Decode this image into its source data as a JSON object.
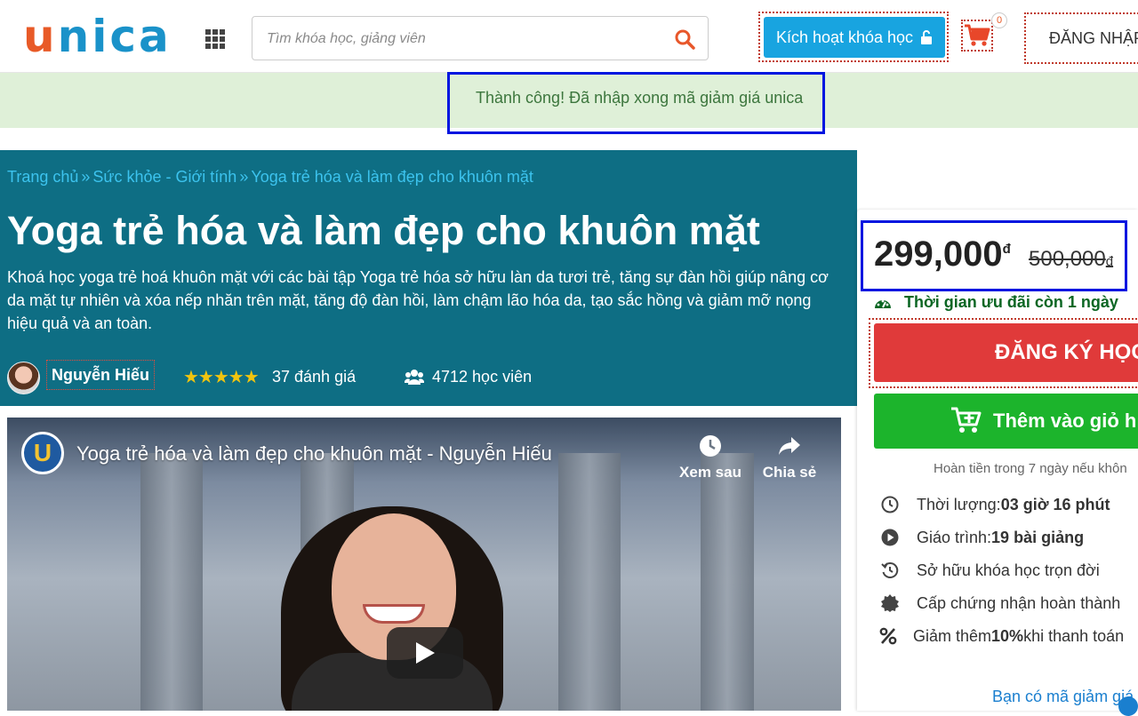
{
  "header": {
    "logo": "unica",
    "search_placeholder": "Tìm khóa học, giảng viên",
    "activate_label": "Kích hoạt khóa học",
    "cart_count": "0",
    "login_label": "ĐĂNG NHẬP"
  },
  "banner": {
    "message": "Thành công! Đã nhập xong mã giảm giá unica"
  },
  "breadcrumb": {
    "items": [
      "Trang chủ",
      "Sức khỏe - Giới tính",
      "Yoga trẻ hóa và làm đẹp cho khuôn mặt"
    ],
    "separator": "»"
  },
  "course": {
    "title": "Yoga trẻ hóa và làm đẹp cho khuôn mặt",
    "description": "Khoá học yoga trẻ hoá khuôn mặt với các bài tập Yoga trẻ hóa sở hữu làn da tươi trẻ, tăng sự đàn hồi giúp nâng cơ da mặt tự nhiên và xóa nếp nhăn trên mặt, tăng độ đàn hồi, làm chậm lão hóa da, tạo sắc hồng và giảm mỡ nọng hiệu quả và an toàn.",
    "author": "Nguyễn Hiếu",
    "stars": "★★★★★",
    "rating_count": "37 đánh giá",
    "students": "4712 học viên"
  },
  "video": {
    "title": "Yoga trẻ hóa và làm đẹp cho khuôn mặt - Nguyễn Hiếu",
    "logo_letter": "U",
    "watch_later": "Xem sau",
    "share": "Chia sẻ"
  },
  "sidebar": {
    "price_current": "299,000",
    "price_original": "500,000",
    "currency": "đ",
    "promo": "Thời gian ưu đãi còn 1 ngày",
    "register_label": "ĐĂNG KÝ HỌC",
    "add_cart_label": "Thêm vào giỏ h",
    "refund_note": "Hoàn tiền trong 7 ngày nếu khôn",
    "features": [
      {
        "label": "Thời lượng: ",
        "value": "03 giờ 16 phút",
        "suffix": ""
      },
      {
        "label": "Giáo trình: ",
        "value": "19 bài giảng",
        "suffix": ""
      },
      {
        "label": "Sở hữu khóa học trọn đời",
        "value": "",
        "suffix": ""
      },
      {
        "label": "Cấp chứng nhận hoàn thành",
        "value": "",
        "suffix": ""
      },
      {
        "label": "Giảm thêm ",
        "value": "10%",
        "suffix": " khi thanh toán"
      }
    ],
    "coupon_link": "Bạn có mã giảm giá"
  },
  "colors": {
    "hero_bg": "#0e6e84",
    "accent_blue": "#18a4e0",
    "register_red": "#e03a3a",
    "cart_green": "#1cb42c",
    "banner_green": "#dff0d8"
  }
}
